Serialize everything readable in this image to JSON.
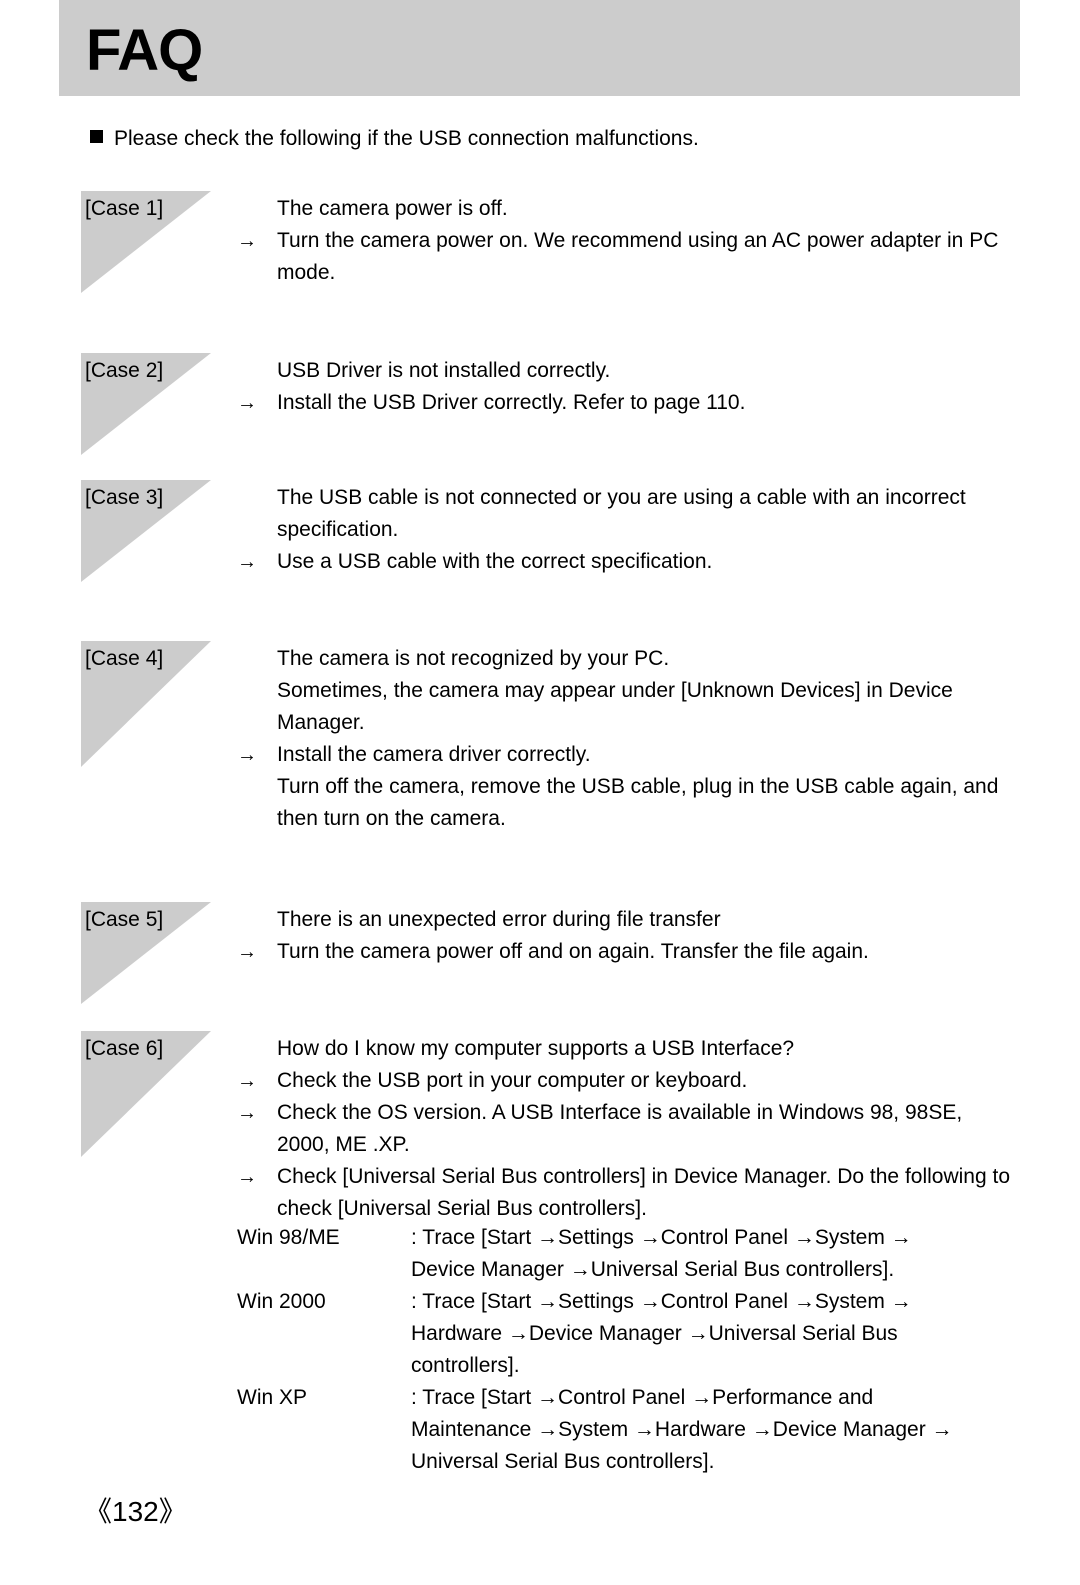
{
  "header": {
    "title": "FAQ",
    "band_color": "#cccccc"
  },
  "intro": {
    "bullet": "filled-square",
    "text": "Please check the following if the USB connection malfunctions."
  },
  "arrow_glyph": "→",
  "cases": [
    {
      "label": "[Case 1]",
      "lines": [
        {
          "arrow": false,
          "text": "The camera power is off."
        },
        {
          "arrow": true,
          "text": "Turn the camera power on. We recommend using an AC power adapter in PC"
        },
        {
          "arrow": false,
          "text": "mode."
        }
      ]
    },
    {
      "label": "[Case 2]",
      "lines": [
        {
          "arrow": false,
          "text": "USB Driver is not installed correctly."
        },
        {
          "arrow": true,
          "text": "Install the USB Driver correctly. Refer to page 110."
        }
      ]
    },
    {
      "label": "[Case 3]",
      "lines": [
        {
          "arrow": false,
          "text": "The USB cable is not connected or you are using a cable with an incorrect"
        },
        {
          "arrow": false,
          "text": "specification."
        },
        {
          "arrow": true,
          "text": "Use a USB cable with the correct specification."
        }
      ]
    },
    {
      "label": "[Case 4]",
      "lines": [
        {
          "arrow": false,
          "text": "The camera is not recognized by your PC."
        },
        {
          "arrow": false,
          "text": "Sometimes, the camera may appear under [Unknown Devices] in Device"
        },
        {
          "arrow": false,
          "text": "Manager."
        },
        {
          "arrow": true,
          "text": "Install the camera driver correctly."
        },
        {
          "arrow": false,
          "text": "Turn off the camera, remove the USB cable, plug in the USB cable again, and"
        },
        {
          "arrow": false,
          "text": "then turn on the camera."
        }
      ]
    },
    {
      "label": "[Case 5]",
      "lines": [
        {
          "arrow": false,
          "text": "There is an unexpected error during file transfer"
        },
        {
          "arrow": true,
          "text": "Turn the camera power off and on again. Transfer the file again."
        }
      ]
    },
    {
      "label": "[Case 6]",
      "lines": [
        {
          "arrow": false,
          "text": "How do I know my computer supports a USB Interface?"
        },
        {
          "arrow": true,
          "text": "Check the USB port in your computer or keyboard."
        },
        {
          "arrow": true,
          "text": "Check the OS version. A USB Interface is available in Windows 98, 98SE,"
        },
        {
          "arrow": false,
          "text": "2000, ME .XP."
        },
        {
          "arrow": true,
          "text": "Check [Universal Serial Bus controllers] in Device Manager. Do the following to"
        },
        {
          "arrow": false,
          "text": "check [Universal Serial Bus controllers]."
        }
      ]
    }
  ],
  "win_table": [
    {
      "name": "Win 98/ME",
      "steps": ": Trace [Start →Settings →Control Panel →System →",
      "continuation": [
        "Device Manager  →Universal Serial Bus controllers]."
      ]
    },
    {
      "name": "Win 2000",
      "steps": ": Trace [Start →Settings →Control Panel →System →",
      "continuation": [
        "Hardware →Device Manager →Universal Serial Bus",
        "controllers]."
      ]
    },
    {
      "name": "Win XP",
      "steps": ": Trace [Start →Control Panel →Performance and",
      "continuation": [
        "Maintenance →System →Hardware →Device Manager →",
        "Universal Serial Bus controllers]."
      ]
    }
  ],
  "footer": {
    "page_number": "《132》"
  }
}
